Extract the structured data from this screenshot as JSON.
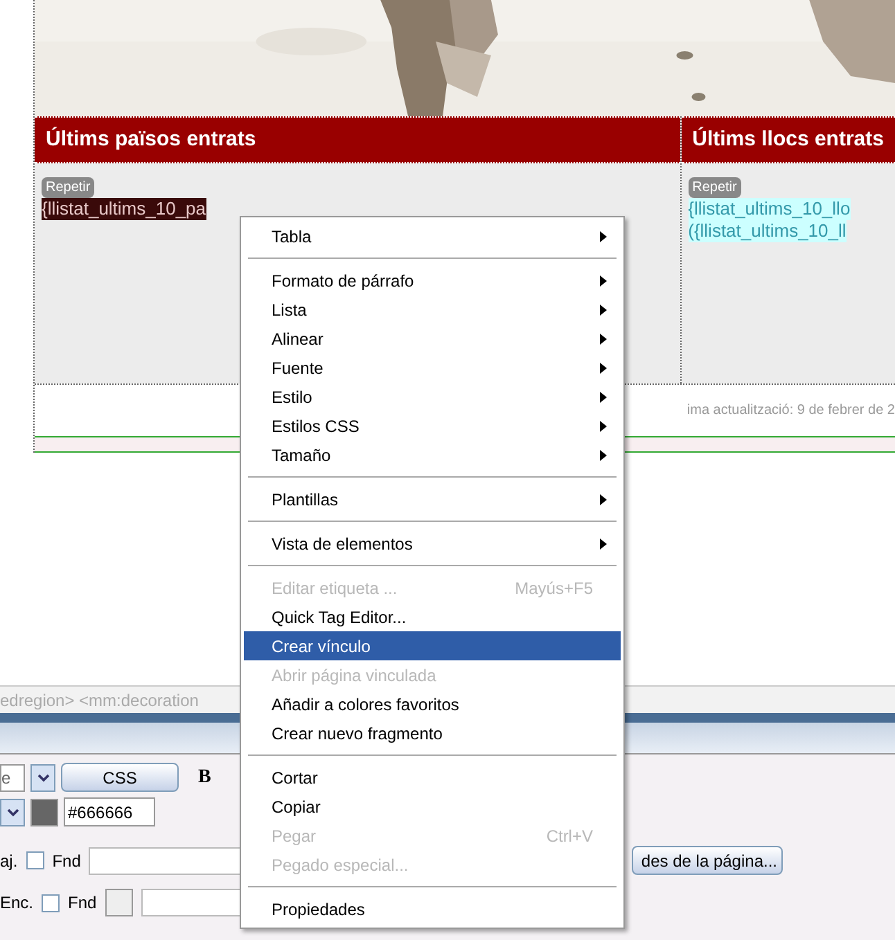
{
  "panels": [
    {
      "title": "Últims països entrats",
      "badge": "Repetir",
      "lines": [
        "{llistat_ultims_10_pa"
      ],
      "kind": "dark"
    },
    {
      "title": "Últims llocs entrats",
      "badge": "Repetir",
      "lines": [
        "{llistat_ultims_10_llo",
        "({llistat_ultims_10_ll"
      ],
      "kind": "cyan"
    }
  ],
  "footer": "ima actualització: 9 de febrer de 2",
  "tag_selector": "edregion> <mm:decoration",
  "properties": {
    "row1_select": "e",
    "css_button": "CSS",
    "bold": "B",
    "color_value": "#666666",
    "row3_label": "aj.",
    "row3_checked": false,
    "row3_fnd": "Fnd",
    "page_button": "des de la página...",
    "row4_label": "Enc.",
    "row4_checked": false,
    "row4_fnd": "Fnd"
  },
  "context_menu": [
    {
      "kind": "item",
      "label": "Tabla",
      "submenu": true,
      "disabled": false,
      "selected": false
    },
    {
      "kind": "separator"
    },
    {
      "kind": "item",
      "label": "Formato de párrafo",
      "submenu": true,
      "disabled": false,
      "selected": false
    },
    {
      "kind": "item",
      "label": "Lista",
      "submenu": true,
      "disabled": false,
      "selected": false
    },
    {
      "kind": "item",
      "label": "Alinear",
      "submenu": true,
      "disabled": false,
      "selected": false
    },
    {
      "kind": "item",
      "label": "Fuente",
      "submenu": true,
      "disabled": false,
      "selected": false
    },
    {
      "kind": "item",
      "label": "Estilo",
      "submenu": true,
      "disabled": false,
      "selected": false
    },
    {
      "kind": "item",
      "label": "Estilos CSS",
      "submenu": true,
      "disabled": false,
      "selected": false
    },
    {
      "kind": "item",
      "label": "Tamaño",
      "submenu": true,
      "disabled": false,
      "selected": false
    },
    {
      "kind": "separator"
    },
    {
      "kind": "item",
      "label": "Plantillas",
      "submenu": true,
      "disabled": false,
      "selected": false
    },
    {
      "kind": "separator"
    },
    {
      "kind": "item",
      "label": "Vista de elementos",
      "submenu": true,
      "disabled": false,
      "selected": false
    },
    {
      "kind": "separator"
    },
    {
      "kind": "item",
      "label": "Editar etiqueta ...",
      "shortcut": "Mayús+F5",
      "submenu": false,
      "disabled": true,
      "selected": false
    },
    {
      "kind": "item",
      "label": "Quick Tag Editor...",
      "submenu": false,
      "disabled": false,
      "selected": false
    },
    {
      "kind": "item",
      "label": "Crear vínculo",
      "submenu": false,
      "disabled": false,
      "selected": true
    },
    {
      "kind": "item",
      "label": "Abrir página vinculada",
      "submenu": false,
      "disabled": true,
      "selected": false
    },
    {
      "kind": "item",
      "label": "Añadir a colores favoritos",
      "submenu": false,
      "disabled": false,
      "selected": false
    },
    {
      "kind": "item",
      "label": "Crear nuevo fragmento",
      "submenu": false,
      "disabled": false,
      "selected": false
    },
    {
      "kind": "separator"
    },
    {
      "kind": "item",
      "label": "Cortar",
      "submenu": false,
      "disabled": false,
      "selected": false
    },
    {
      "kind": "item",
      "label": "Copiar",
      "submenu": false,
      "disabled": false,
      "selected": false
    },
    {
      "kind": "item",
      "label": "Pegar",
      "shortcut": "Ctrl+V",
      "submenu": false,
      "disabled": true,
      "selected": false
    },
    {
      "kind": "item",
      "label": "Pegado especial...",
      "submenu": false,
      "disabled": true,
      "selected": false
    },
    {
      "kind": "separator"
    },
    {
      "kind": "item",
      "label": "Propiedades",
      "submenu": false,
      "disabled": false,
      "selected": false
    }
  ]
}
